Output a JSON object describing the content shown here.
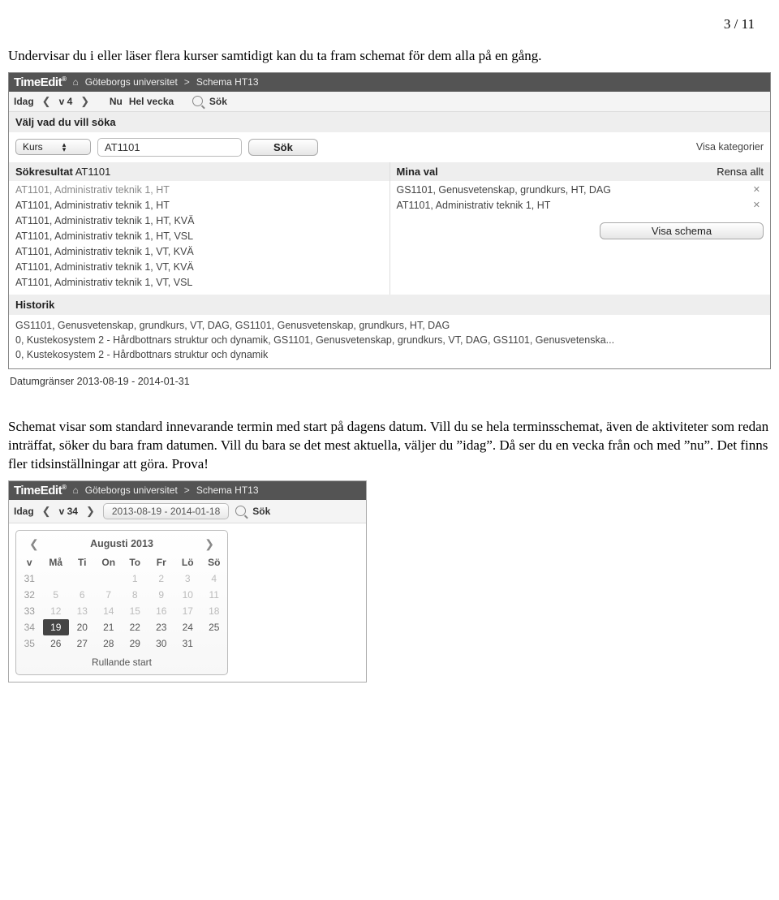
{
  "page_indicator": "3 / 11",
  "intro": "Undervisar du i eller läser flera kurser samtidigt kan du ta fram schemat för dem alla på en gång.",
  "mid": "Schemat visar som standard innevarande termin med start på dagens datum. Vill du se hela terminsschemat, även de aktiviteter som redan inträffat, söker du bara fram datumen. Vill du bara se det mest aktuella, väljer du ”idag”. Då ser du en vecka från och med ”nu”. Det finns fler tidsinställningar att göra. Prova!",
  "app1": {
    "logo": "TimeEdit",
    "breadcrumb": [
      "Göteborgs universitet",
      "Schema HT13"
    ],
    "toolbar": {
      "idag": "Idag",
      "week": "v 4",
      "nu": "Nu",
      "hel": "Hel vecka",
      "sok": "Sök"
    },
    "search": {
      "heading": "Välj vad du vill söka",
      "selector": "Kurs",
      "query": "AT1101",
      "btn": "Sök",
      "visa_kat": "Visa kategorier",
      "results_hdr": "Sökresultat",
      "results_for": "AT1101",
      "results": [
        "AT1101, Administrativ teknik 1, HT",
        "AT1101, Administrativ teknik 1, HT",
        "AT1101, Administrativ teknik 1, HT, KVÄ",
        "AT1101, Administrativ teknik 1, HT, VSL",
        "AT1101, Administrativ teknik 1, VT, KVÄ",
        "AT1101, Administrativ teknik 1, VT, KVÄ",
        "AT1101, Administrativ teknik 1, VT, VSL"
      ],
      "selections_hdr": "Mina val",
      "rensa": "Rensa allt",
      "selections": [
        "GS1101, Genusvetenskap, grundkurs, HT, DAG",
        "AT1101, Administrativ teknik 1, HT"
      ],
      "visa_schema": "Visa schema",
      "historik_hdr": "Historik",
      "historik": [
        "GS1101, Genusvetenskap, grundkurs, VT, DAG, GS1101, Genusvetenskap, grundkurs, HT, DAG",
        "0, Kustekosystem 2 - Hårdbottnars struktur och dynamik, GS1101, Genusvetenskap, grundkurs, VT, DAG, GS1101, Genusvetenska...",
        "0, Kustekosystem 2 - Hårdbottnars struktur och dynamik"
      ]
    },
    "daterange": "Datumgränser 2013-08-19 - 2014-01-31"
  },
  "app2": {
    "logo": "TimeEdit",
    "breadcrumb": [
      "Göteborgs universitet",
      "Schema HT13"
    ],
    "toolbar": {
      "idag": "Idag",
      "week": "v 34",
      "daterange": "2013-08-19 - 2014-01-18",
      "sok": "Sök"
    },
    "cal": {
      "month": "Augusti 2013",
      "days": [
        "Må",
        "Ti",
        "On",
        "To",
        "Fr",
        "Lö",
        "Sö"
      ],
      "v": "v",
      "rows": [
        {
          "w": "31",
          "d": [
            "",
            "",
            "",
            "1",
            "2",
            "3",
            "4"
          ],
          "muted": [
            3,
            4,
            5,
            6
          ]
        },
        {
          "w": "32",
          "d": [
            "5",
            "6",
            "7",
            "8",
            "9",
            "10",
            "11"
          ],
          "muted": [
            0,
            1,
            2,
            3,
            4,
            5,
            6
          ]
        },
        {
          "w": "33",
          "d": [
            "12",
            "13",
            "14",
            "15",
            "16",
            "17",
            "18"
          ],
          "muted": [
            0,
            1,
            2,
            3,
            4,
            5,
            6
          ]
        },
        {
          "w": "34",
          "d": [
            "19",
            "20",
            "21",
            "22",
            "23",
            "24",
            "25"
          ],
          "sel": 0
        },
        {
          "w": "35",
          "d": [
            "26",
            "27",
            "28",
            "29",
            "30",
            "31",
            ""
          ]
        }
      ],
      "rolling": "Rullande start"
    }
  }
}
